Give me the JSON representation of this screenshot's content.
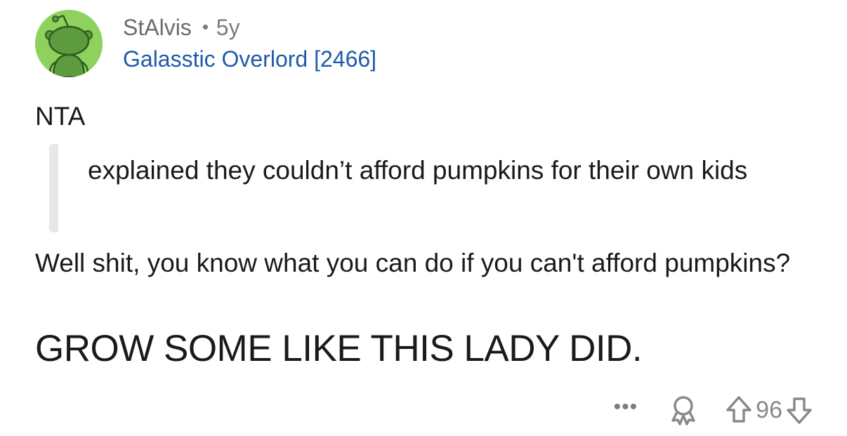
{
  "comment": {
    "username": "StAlvis",
    "age": "5y",
    "flair": "Galasstic Overlord [2466]",
    "verdict": "NTA",
    "quote": "explained they couldn’t afford pumpkins for their own kids",
    "paragraph": "Well shit, you know what you can do if you can't afford pumpkins?",
    "shout": "GROW SOME LIKE THIS LADY DID."
  },
  "actions": {
    "more_label": "•••",
    "score": "96"
  },
  "colors": {
    "avatar_bg": "#8fd15d",
    "flair": "#1f5aa8",
    "meta_gray": "#7c7c7c"
  }
}
